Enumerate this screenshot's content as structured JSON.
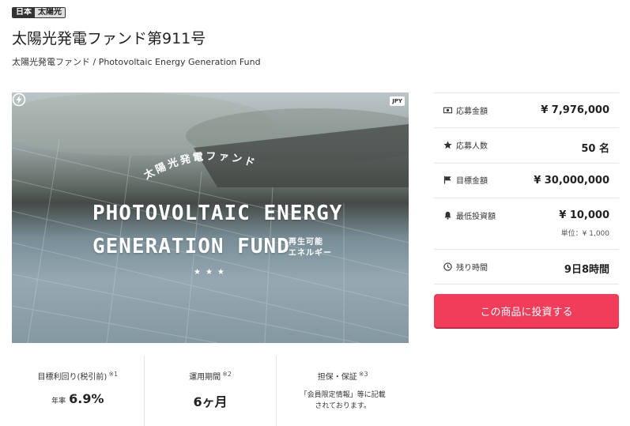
{
  "tags": {
    "country": "日本",
    "category": "太陽光"
  },
  "title": "太陽光発電ファンド第911号",
  "subtitle": "太陽光発電ファンド / Photovoltaic Energy Generation Fund",
  "hero": {
    "currency_badge": "JPY",
    "arc_text": "太陽光発電ファンド",
    "line1": "PHOTOVOLTAIC ENERGY",
    "line2": "GENERATION FUND",
    "side_line1": "再生可能",
    "side_line2": "エネルギー",
    "stars": "★★★"
  },
  "info": {
    "applied_amount": {
      "label": "応募金額",
      "value": "¥ 7,976,000",
      "icon": "money-icon"
    },
    "applicants": {
      "label": "応募人数",
      "value": "50 名",
      "icon": "star-icon"
    },
    "target_amount": {
      "label": "目標金額",
      "value": "¥ 30,000,000",
      "icon": "flag-icon"
    },
    "min_investment": {
      "label": "最低投資額",
      "value": "¥ 10,000",
      "note": "単位：¥ 1,000",
      "icon": "bell-icon"
    },
    "time_left": {
      "label": "残り時間",
      "value": "9日8時間",
      "icon": "clock-icon"
    }
  },
  "invest_button": "この商品に投資する",
  "stats": {
    "yield": {
      "label": "目標利回り(税引前)",
      "mark": "※1",
      "prefix": "年率",
      "value": "6.9%"
    },
    "period": {
      "label": "運用期間",
      "mark": "※2",
      "value": "6ヶ月"
    },
    "security": {
      "label": "担保・保証",
      "mark": "※3",
      "text_line1": "「会員限定情報」等に記載",
      "text_line2": "されております。"
    }
  },
  "colors": {
    "accent": "#f23d5a",
    "tag_dark": "#333333"
  }
}
